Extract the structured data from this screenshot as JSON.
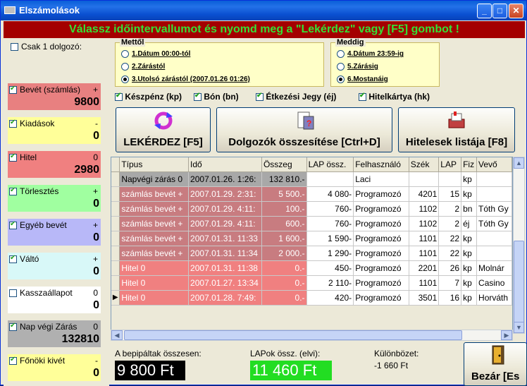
{
  "window": {
    "title": "Elszámolások"
  },
  "headline": "Válassz időintervallumot és nyomd meg a \"Lekérdez\" vagy [F5] gombot !",
  "left": {
    "single_worker_label": "Csak 1 dolgozó:",
    "cards": [
      {
        "label": "Bevét (számlás)",
        "sign": "+",
        "value": "9800",
        "checked": true,
        "color": "#e88080"
      },
      {
        "label": "Kiadások",
        "sign": "-",
        "value": "0",
        "checked": true,
        "color": "#ffff99"
      },
      {
        "label": "Hitel",
        "sign": "0",
        "value": "2980",
        "checked": true,
        "color": "#f08080"
      },
      {
        "label": "Törlesztés",
        "sign": "+",
        "value": "0",
        "checked": true,
        "color": "#a0ffa0"
      },
      {
        "label": "Egyéb bevét",
        "sign": "+",
        "value": "0",
        "checked": true,
        "color": "#b8b8f8"
      },
      {
        "label": "Váltó",
        "sign": "+",
        "value": "0",
        "checked": true,
        "color": "#d8f8f8"
      },
      {
        "label": "Kasszaállapot",
        "sign": "0",
        "value": "0",
        "checked": false,
        "color": "#ffffff"
      },
      {
        "label": "Nap végi Zárás",
        "sign": "0",
        "value": "132810",
        "checked": true,
        "color": "#b0b0b0"
      },
      {
        "label": "Főnöki kivét",
        "sign": "-",
        "value": "0",
        "checked": true,
        "color": "#ffff99"
      }
    ]
  },
  "from": {
    "legend": "Mettől",
    "options": [
      "1.Dátum 00:00-tól",
      "2.Zárástól",
      "3.Utolsó zárástól (2007.01.26 01:26)"
    ],
    "selected": 2
  },
  "to": {
    "legend": "Meddig",
    "options": [
      "4.Dátum 23:59-ig",
      "5.Zárásig",
      "6.Mostanáig"
    ],
    "selected": 2
  },
  "paymodes": [
    "Készpénz (kp)",
    "Bón (bn)",
    "Étkezési Jegy (éj)",
    "Hitelkártya (hk)"
  ],
  "buttons": {
    "query": "LEKÉRDEZ [F5]",
    "workers": "Dolgozók összesítése [Ctrl+D]",
    "credits": "Hitelesek listája [F8]",
    "close": "Bezár [Es"
  },
  "table": {
    "columns": [
      "Típus",
      "Idő",
      "Összeg",
      "LAP össz.",
      "Felhasználó",
      "Szék",
      "LAP",
      "Fiz",
      "Vevő"
    ],
    "rows": [
      [
        "Napvégi zárás 0",
        "2007.01.26. 1:26:",
        "132 810.-",
        "",
        "Laci",
        "",
        "",
        "kp",
        ""
      ],
      [
        "számlás bevét +",
        "2007.01.29. 2:31:",
        "5 500.-",
        "4 080-",
        "Programozó",
        "4201",
        "15",
        "kp",
        ""
      ],
      [
        "számlás bevét +",
        "2007.01.29. 4:11:",
        "100.-",
        "760-",
        "Programozó",
        "1102",
        "2",
        "bn",
        "Tóth Gy"
      ],
      [
        "számlás bevét +",
        "2007.01.29. 4:11:",
        "600.-",
        "760-",
        "Programozó",
        "1102",
        "2",
        "éj",
        "Tóth Gy"
      ],
      [
        "számlás bevét +",
        "2007.01.31. 11:33",
        "1 600.-",
        "1 590-",
        "Programozó",
        "1101",
        "22",
        "kp",
        ""
      ],
      [
        "számlás bevét +",
        "2007.01.31. 11:34",
        "2 000.-",
        "1 290-",
        "Programozó",
        "1101",
        "22",
        "kp",
        ""
      ],
      [
        "Hitel          0",
        "2007.01.31. 11:38",
        "0.-",
        "450-",
        "Programozó",
        "2201",
        "26",
        "kp",
        "Molnár"
      ],
      [
        "Hitel          0",
        "2007.01.27. 13:34",
        "0.-",
        "2 110-",
        "Programozó",
        "1101",
        "7",
        "kp",
        "Casino"
      ],
      [
        "Hitel          0",
        "2007.01.28. 7:49:",
        "0.-",
        "420-",
        "Programozó",
        "3501",
        "16",
        "kp",
        "Horváth"
      ]
    ],
    "current_row": 8
  },
  "footer": {
    "paid_label": "A bepipáltak összesen:",
    "paid_value": "9 800 Ft",
    "lap_label": "LAPok össz. (elvi):",
    "lap_value": "11 460 Ft",
    "diff_label": "Különbözet:",
    "diff_value": "-1 660 Ft"
  }
}
